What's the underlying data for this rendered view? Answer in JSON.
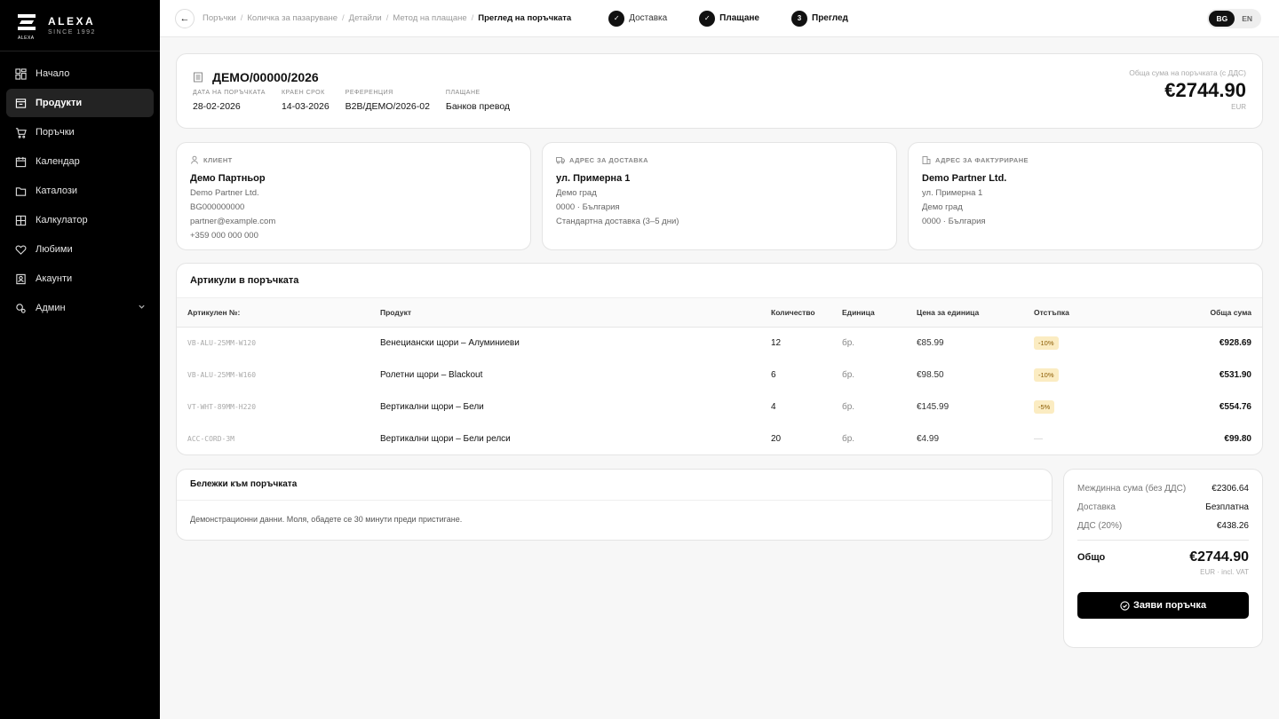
{
  "brand": {
    "name": "ALEXA",
    "since": "SINCE 1992",
    "mark_text": "ALEXA"
  },
  "sidebar": {
    "items": [
      {
        "label": "Начало",
        "icon": "grid-icon"
      },
      {
        "label": "Продукти",
        "icon": "box-icon",
        "active": true
      },
      {
        "label": "Поръчки",
        "icon": "cart-icon"
      },
      {
        "label": "Календар",
        "icon": "calendar-icon"
      },
      {
        "label": "Каталози",
        "icon": "folder-icon"
      },
      {
        "label": "Калкулатор",
        "icon": "calculator-icon"
      },
      {
        "label": "Любими",
        "icon": "heart-icon"
      },
      {
        "label": "Акаунти",
        "icon": "accounts-icon"
      },
      {
        "label": "Админ",
        "icon": "admin-icon",
        "expandable": true
      }
    ]
  },
  "topbar": {
    "breadcrumb": [
      "Поръчки",
      "Количка за пазаруване",
      "Детайли",
      "Метод на плащане",
      "Преглед на поръчката"
    ],
    "steps": [
      {
        "label": "Доставка",
        "marker": "✓"
      },
      {
        "label": "Плащане",
        "marker": "✓"
      },
      {
        "label": "Преглед",
        "marker": "3"
      }
    ],
    "lang": {
      "active": "BG",
      "other": "EN"
    }
  },
  "order": {
    "number": "ДЕМО/00000/2026",
    "meta": [
      {
        "label": "Дата на поръчката",
        "value": "28-02-2026"
      },
      {
        "label": "Краен срок",
        "value": "14-03-2026"
      },
      {
        "label": "Референция",
        "value": "B2B/ДЕМО/2026-02"
      },
      {
        "label": "Плащане",
        "value": "Банков превод"
      }
    ],
    "total_label": "Обща сума на поръчката (с ДДС)",
    "total": "€2744.90",
    "currency": "EUR"
  },
  "client": {
    "header": "Клиент",
    "name": "Демо Партньор",
    "lines": [
      "Demo Partner Ltd.",
      "BG000000000",
      "partner@example.com",
      "+359 000 000 000"
    ]
  },
  "shipping": {
    "header": "Адрес за доставка",
    "name": "ул. Примерна 1",
    "lines": [
      "Демо град",
      "0000 · България",
      "Стандартна доставка (3–5 дни)"
    ]
  },
  "billing": {
    "header": "Адрес за фактуриране",
    "name": "Demo Partner Ltd.",
    "lines": [
      "ул. Примерна 1",
      "Демо град",
      "0000 · България"
    ]
  },
  "items": {
    "title": "Артикули в поръчката",
    "columns": [
      "Артикулен №:",
      "Продукт",
      "Количество",
      "Единица",
      "Цена за единица",
      "Отстъпка",
      "Обща сума"
    ],
    "rows": [
      {
        "sku": "VB-ALU-25MM-W120",
        "product": "Венециански щори – Алуминиеви",
        "qty": "12",
        "unit": "бр.",
        "price": "€85.99",
        "discount": "-10%",
        "total": "€928.69"
      },
      {
        "sku": "VB-ALU-25MM-W160",
        "product": "Ролетни щори – Blackout",
        "qty": "6",
        "unit": "бр.",
        "price": "€98.50",
        "discount": "-10%",
        "total": "€531.90"
      },
      {
        "sku": "VT-WHT-89MM-H220",
        "product": "Вертикални щори – Бели",
        "qty": "4",
        "unit": "бр.",
        "price": "€145.99",
        "discount": "-5%",
        "total": "€554.76"
      },
      {
        "sku": "ACC-CORD-3M",
        "product": "Вертикални щори – Бели релси",
        "qty": "20",
        "unit": "бр.",
        "price": "€4.99",
        "discount": "—",
        "total": "€99.80"
      }
    ]
  },
  "notes": {
    "title": "Бележки към поръчката",
    "text": "Демонстрационни данни. Моля, обадете се 30 минути преди пристигане."
  },
  "summary": {
    "subtotal_label": "Междинна сума (без ДДС)",
    "subtotal": "€2306.64",
    "shipping_label": "Доставка",
    "shipping": "Безплатна",
    "vat_label": "ДДС (20%)",
    "vat": "€438.26",
    "total_label": "Общо",
    "total": "€2744.90",
    "total_note": "EUR · incl. VAT",
    "submit_label": "Заяви поръчка"
  }
}
